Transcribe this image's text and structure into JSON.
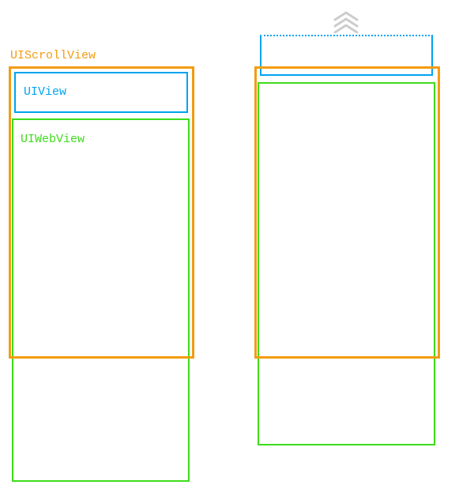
{
  "colors": {
    "orange": "#F39C12",
    "blue": "#00A4F0",
    "green": "#3EDC1B",
    "arrow": "#CCCCCC"
  },
  "labels": {
    "scrollview": "UIScrollView",
    "uiview": "UIView",
    "uiwebview": "UIWebView"
  }
}
